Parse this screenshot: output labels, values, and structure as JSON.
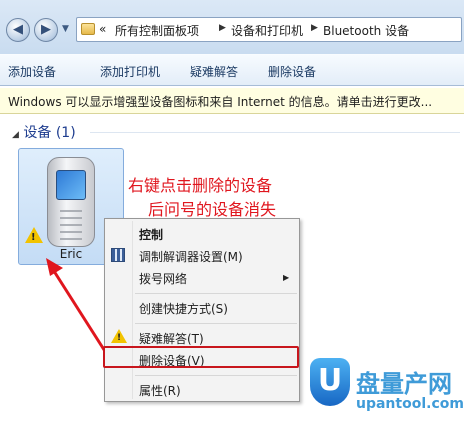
{
  "address_bar": {
    "back_glyph": "◀",
    "forward_glyph": "▶",
    "breadcrumbs": [
      "«",
      "所有控制面板项",
      "设备和打印机",
      "Bluetooth 设备"
    ],
    "separator_glyph": "▶"
  },
  "toolbar": {
    "buttons": [
      "添加设备",
      "添加打印机",
      "疑难解答",
      "删除设备"
    ]
  },
  "info_bar": {
    "text": "Windows 可以显示增强型设备图标和来自 Internet 的信息。请单击进行更改..."
  },
  "device_group": {
    "expand_glyph": "◢",
    "header": "设备 (1)",
    "devices": [
      {
        "name": "Eric",
        "icon": "mobile-phone-icon",
        "status_icon": "warning-icon"
      }
    ]
  },
  "annotation": {
    "line1": "右键点击删除的设备",
    "line2": "后问号的设备消失",
    "color": "#e0161e"
  },
  "context_menu": {
    "items": [
      {
        "label": "控制",
        "bold": true
      },
      {
        "label": "调制解调器设置(M)",
        "icon": "modem-icon"
      },
      {
        "label": "拨号网络",
        "submenu": true
      },
      {
        "label": "创建快捷方式(S)"
      },
      {
        "label": "疑难解答(T)",
        "icon": "warning-icon"
      },
      {
        "label": "删除设备(V)",
        "highlighted": true
      },
      {
        "label": "属性(R)"
      }
    ],
    "submenu_glyph": "▶"
  },
  "watermark": {
    "badge": "U",
    "cn": "盘量产网",
    "en": "upantool.com"
  }
}
